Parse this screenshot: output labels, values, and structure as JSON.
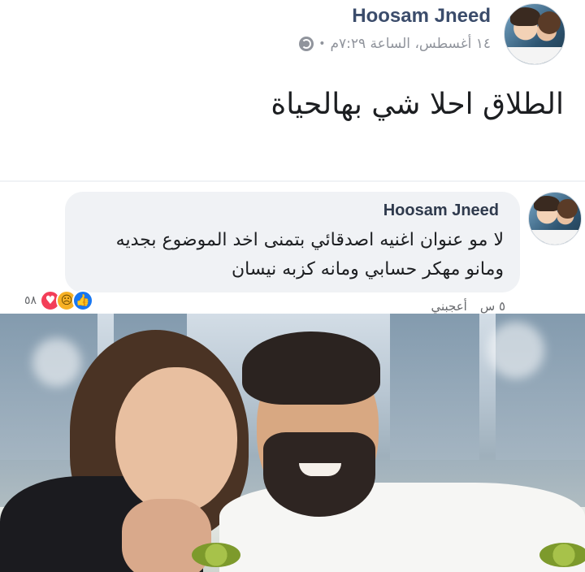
{
  "post": {
    "author": "Hoosam Jneed",
    "time": "١٤ أغسطس، الساعة ٧:٢٩م",
    "separator": "•",
    "privacy_icon": "globe-icon",
    "text": "الطلاق احلا شي بهالحياة"
  },
  "comment": {
    "author": "Hoosam Jneed",
    "text_line1": "لا مو عنوان اغنيه اصدقائي بتمنى اخد الموضوع بجديه",
    "text_line2": "ومانو مهكر حسابي ومانه كزبه نيسان",
    "reaction_count": "٥٨",
    "reactions": [
      "like-icon",
      "sad-icon",
      "love-icon"
    ],
    "actions": {
      "age": "٥ س",
      "like": "أعجبني"
    }
  },
  "colors": {
    "author": "#3b4c6b",
    "meta": "#90949c",
    "bubble": "#f0f2f5",
    "like": "#1877f2",
    "love": "#f33e58",
    "sad": "#f7b125"
  }
}
